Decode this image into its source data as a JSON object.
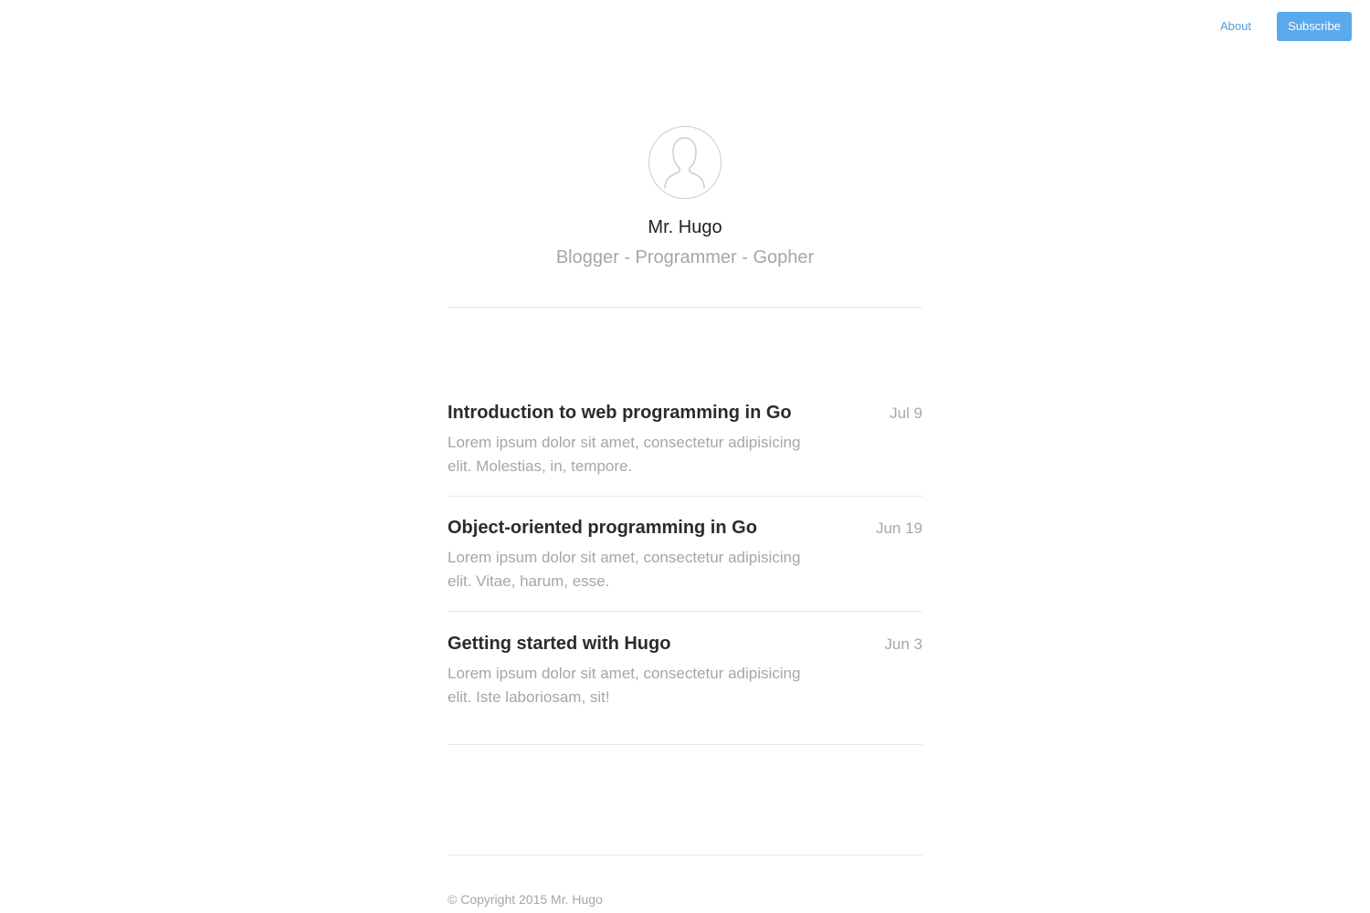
{
  "nav": {
    "about_label": "About",
    "subscribe_label": "Subscribe",
    "accent_color": "#5aa9ec"
  },
  "profile": {
    "avatar_icon": "user-silhouette-icon",
    "name": "Mr. Hugo",
    "tagline": "Blogger - Programmer - Gopher"
  },
  "posts": [
    {
      "title": "Introduction to web programming in Go",
      "date": "Jul 9",
      "excerpt": "Lorem ipsum dolor sit amet, consectetur adipisicing elit. Molestias, in, tempore."
    },
    {
      "title": "Object-oriented programming in Go",
      "date": "Jun 19",
      "excerpt": "Lorem ipsum dolor sit amet, consectetur adipisicing elit. Vitae, harum, esse."
    },
    {
      "title": "Getting started with Hugo",
      "date": "Jun 3",
      "excerpt": "Lorem ipsum dolor sit amet, consectetur adipisicing elit. Iste laboriosam, sit!"
    }
  ],
  "footer": {
    "copyright": "© Copyright 2015 Mr. Hugo"
  }
}
